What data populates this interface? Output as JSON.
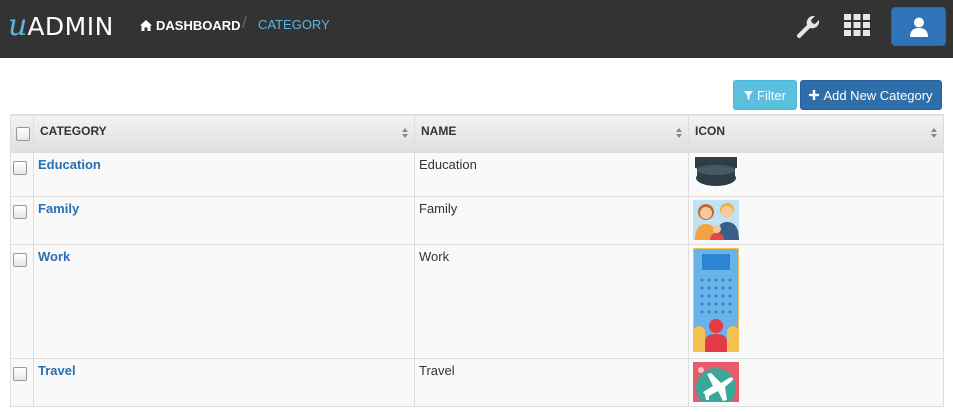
{
  "header": {
    "logo_u": "u",
    "logo_rest": "ADMIN",
    "breadcrumb": {
      "home_label": "DASHBOARD",
      "separator": "/",
      "current_label": "CATEGORY"
    },
    "icons": [
      "wrench-icon",
      "apps-grid-icon",
      "user-icon"
    ],
    "colors": {
      "bar": "#333333",
      "accent": "#5fb4de",
      "user_button": "#2f74b8"
    }
  },
  "toolbar": {
    "filter_label": "Filter",
    "add_label": "Add New Category"
  },
  "table": {
    "columns": [
      "CATEGORY",
      "NAME",
      "ICON"
    ],
    "rows": [
      {
        "category": "Education",
        "name": "Education",
        "icon": "graduation-cap-icon"
      },
      {
        "category": "Family",
        "name": "Family",
        "icon": "family-icon"
      },
      {
        "category": "Work",
        "name": "Work",
        "icon": "office-building-icon"
      },
      {
        "category": "Travel",
        "name": "Travel",
        "icon": "airplane-icon"
      }
    ]
  }
}
